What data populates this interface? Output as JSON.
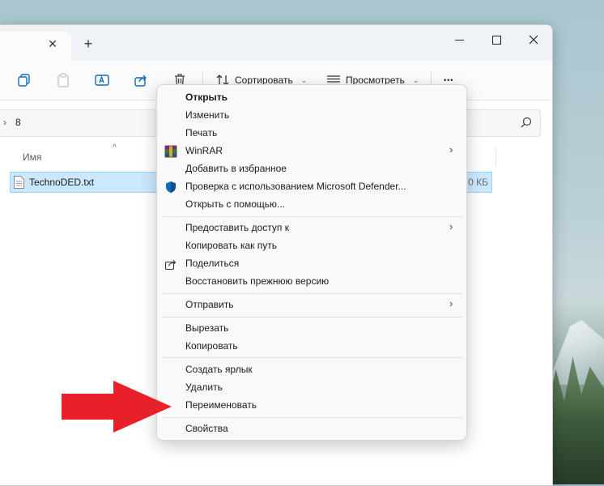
{
  "explorer": {
    "tab_close": "✕",
    "new_tab": "+",
    "toolbar": {
      "sort_label": "Сортировать",
      "view_label": "Просмотреть",
      "more_label": "•••"
    },
    "breadcrumb": {
      "separator": "›",
      "folder": "8"
    },
    "columns": {
      "name": "Имя",
      "sort_arrow": "^"
    },
    "file": {
      "name": "TechnoDED.txt",
      "size": "0 КБ"
    }
  },
  "context_menu": {
    "items": [
      {
        "label": "Открыть",
        "bold": true
      },
      {
        "label": "Изменить"
      },
      {
        "label": "Печать"
      },
      {
        "label": "WinRAR",
        "icon": "winrar-icon",
        "submenu": true
      },
      {
        "label": "Добавить в избранное"
      },
      {
        "label": "Проверка с использованием Microsoft Defender...",
        "icon": "defender-shield-icon"
      },
      {
        "label": "Открыть с помощью..."
      },
      {
        "label": "Предоставить доступ к",
        "submenu": true
      },
      {
        "label": "Копировать как путь"
      },
      {
        "label": "Поделиться",
        "icon": "share-icon"
      },
      {
        "label": "Восстановить прежнюю версию"
      },
      {
        "label": "Отправить",
        "submenu": true
      },
      {
        "label": "Вырезать"
      },
      {
        "label": "Копировать"
      },
      {
        "label": "Создать ярлык"
      },
      {
        "label": "Удалить"
      },
      {
        "label": "Переименовать"
      },
      {
        "label": "Свойства"
      }
    ],
    "submenu_glyph": "›"
  },
  "colors": {
    "selection_bg": "#cce8ff",
    "selection_border": "#99d1ff",
    "arrow": "#e8202a",
    "defender_blue": "#0f6cbd"
  }
}
